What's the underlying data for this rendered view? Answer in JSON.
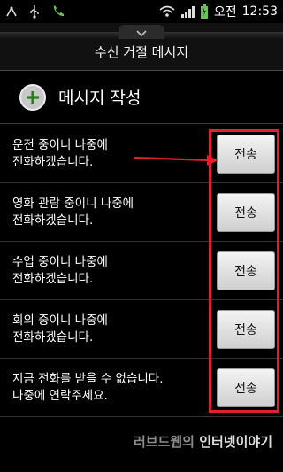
{
  "status_bar": {
    "carrier_text": "오전",
    "time": "12:53",
    "icons": [
      "signal-icon",
      "usb-icon",
      "phone-icon",
      "wifi-icon",
      "cell-signal-icon",
      "battery-icon"
    ]
  },
  "dialog": {
    "title": "수신 거절 메시지",
    "compose_label": "메시지 작성",
    "send_label": "전송",
    "messages": [
      {
        "line1": "운전 중이니 나중에",
        "line2": "전화하겠습니다."
      },
      {
        "line1": "영화 관람 중이니 나중에",
        "line2": "전화하겠습니다."
      },
      {
        "line1": "수업 중이니 나중에",
        "line2": "전화하겠습니다."
      },
      {
        "line1": "회의 중이니 나중에",
        "line2": "전화하겠습니다."
      },
      {
        "line1": "지금 전화를 받을 수 없습니다.",
        "line2": "나중에 연락주세요."
      }
    ]
  },
  "watermark": {
    "part1": "러브드웹의",
    "part2": "인터넷이야기"
  },
  "colors": {
    "highlight": "#e0202a",
    "accent_green": "#6cc05a"
  }
}
